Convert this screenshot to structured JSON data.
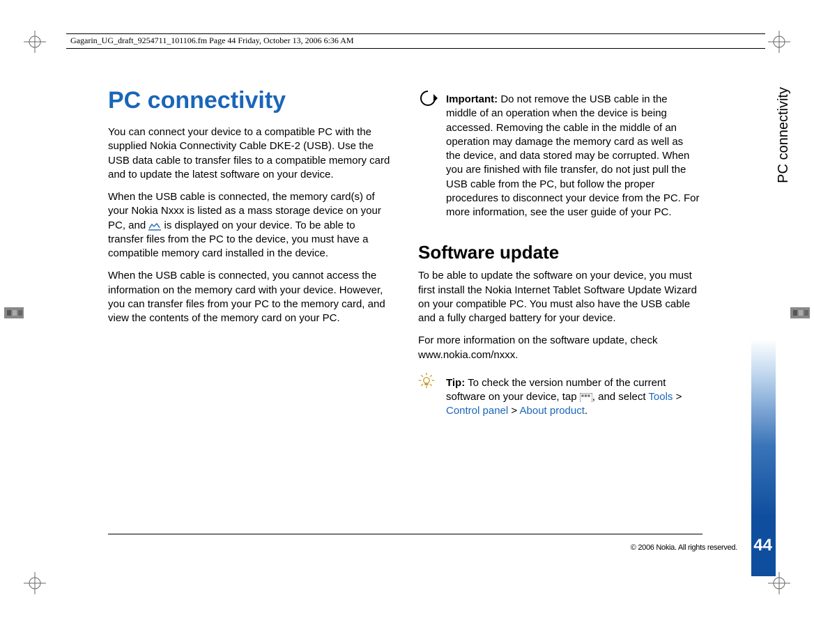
{
  "header": "Gagarin_UG_draft_9254711_101106.fm  Page 44  Friday, October 13, 2006  6:36 AM",
  "title": "PC connectivity",
  "side_tab": "PC connectivity",
  "page_number": "44",
  "copyright": "© 2006 Nokia. All rights reserved.",
  "left": {
    "p1": "You can connect your device to a compatible PC with the supplied Nokia Connectivity Cable DKE-2 (USB). Use the USB data cable to transfer files to a compatible memory card and to update the latest software on your device.",
    "p2a": "When the USB cable is connected, the memory card(s) of your Nokia Nxxx is listed as a mass storage device on your PC, and ",
    "p2b": " is displayed on your device. To be able to transfer files from the PC to the device, you must have a compatible memory card installed in the device.",
    "p3": "When the USB cable is connected, you cannot access the information on the memory card with your device. However, you can transfer files from your PC to the memory card, and view the contents of the memory card on your PC."
  },
  "right": {
    "important_label": "Important:",
    "important_text": " Do not remove the USB cable in the middle of an operation when the device is being accessed. Removing the cable in the middle of an operation may damage the memory card as well as the device, and data stored may be corrupted. When you are finished with file transfer, do not just pull the USB cable from the PC, but follow the proper procedures to disconnect your device from the PC. For more information, see the user guide of your PC.",
    "h2": "Software update",
    "p1": "To be able to update the software on your device, you must first install the Nokia Internet Tablet Software Update Wizard on your compatible PC. You must also have the USB cable and a fully charged battery for your device.",
    "p2": "For more information on the software update, check www.nokia.com/nxxx.",
    "tip_label": "Tip:",
    "tip_text_a": " To check the version number of the current software on your device, tap ",
    "tip_text_b": ", and select ",
    "tip_path1": "Tools",
    "tip_sep": " > ",
    "tip_path2": "Control panel",
    "tip_path3": "About product",
    "tip_dot": "."
  }
}
